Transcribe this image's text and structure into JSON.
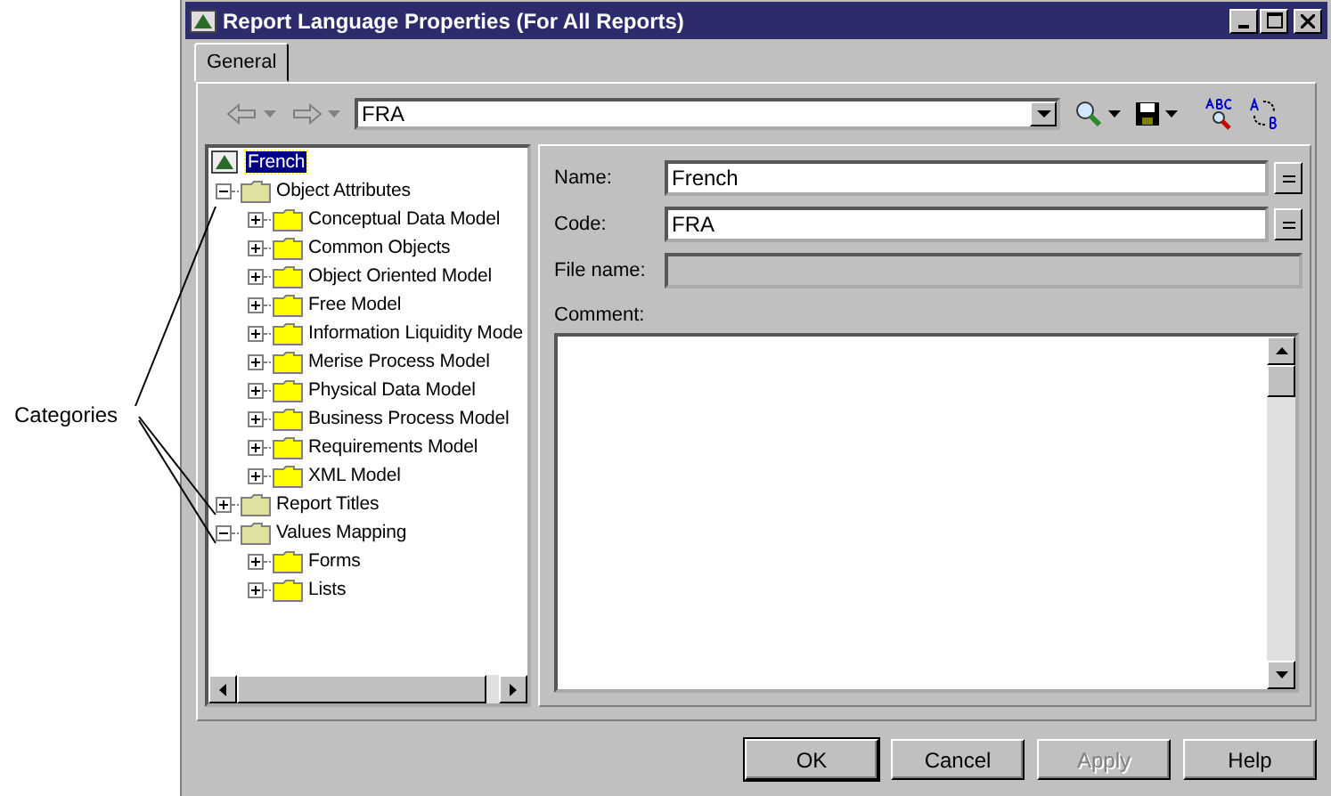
{
  "annotation": {
    "label": "Categories"
  },
  "window": {
    "title": "Report Language Properties (For All Reports)"
  },
  "tabs": [
    {
      "label": "General",
      "selected": true
    }
  ],
  "toolbar": {
    "combo_value": "FRA"
  },
  "tree": {
    "root": {
      "label": "French",
      "selected": true
    },
    "items": [
      {
        "label": "Object Attributes",
        "expanded": true,
        "children": [
          {
            "label": "Conceptual Data Model",
            "expanded": false
          },
          {
            "label": "Common Objects",
            "expanded": false
          },
          {
            "label": "Object Oriented Model",
            "expanded": false
          },
          {
            "label": "Free Model",
            "expanded": false
          },
          {
            "label": "Information Liquidity Mode",
            "expanded": false
          },
          {
            "label": "Merise Process Model",
            "expanded": false
          },
          {
            "label": "Physical Data Model",
            "expanded": false
          },
          {
            "label": "Business Process Model",
            "expanded": false
          },
          {
            "label": "Requirements Model",
            "expanded": false
          },
          {
            "label": "XML Model",
            "expanded": false
          }
        ]
      },
      {
        "label": "Report Titles",
        "expanded": false
      },
      {
        "label": "Values Mapping",
        "expanded": true,
        "children": [
          {
            "label": "Forms",
            "expanded": false
          },
          {
            "label": "Lists",
            "expanded": false
          }
        ]
      }
    ]
  },
  "form": {
    "fields": [
      {
        "label": "Name:",
        "value": "French",
        "kind": "text"
      },
      {
        "label": "Code:",
        "value": "FRA",
        "kind": "text"
      },
      {
        "label": "File name:",
        "kind": "readonly"
      }
    ],
    "comment_label": "Comment:"
  },
  "buttons": [
    {
      "label": "OK",
      "disabled": false,
      "default": true
    },
    {
      "label": "Cancel",
      "disabled": false,
      "default": false
    },
    {
      "label": "Apply",
      "disabled": true,
      "default": false
    },
    {
      "label": "Help",
      "disabled": false,
      "default": false
    }
  ]
}
